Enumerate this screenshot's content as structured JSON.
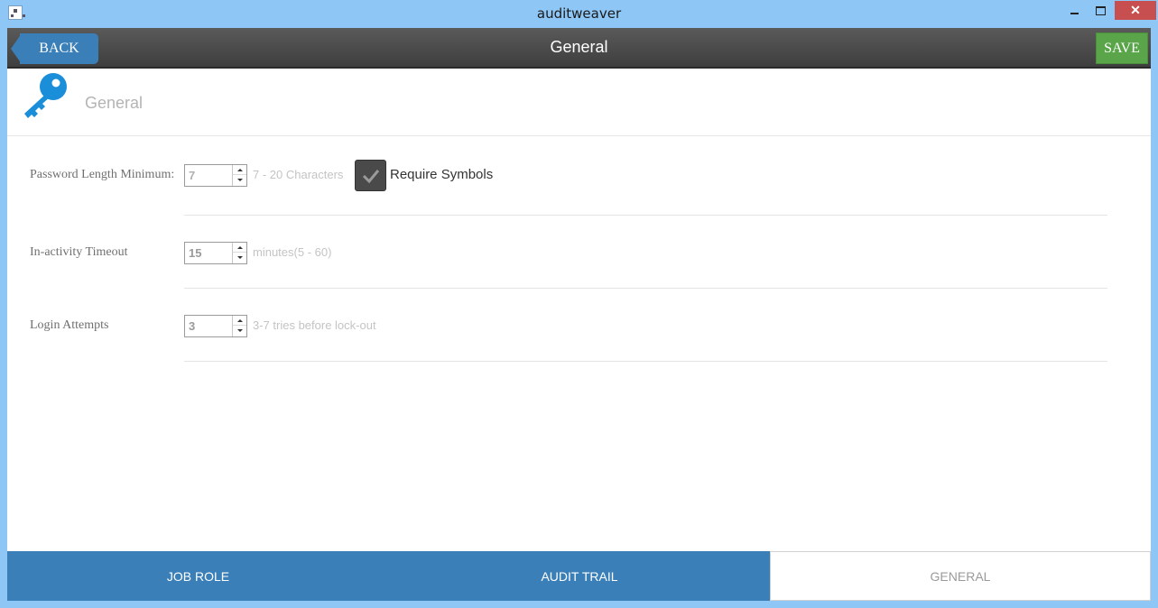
{
  "window": {
    "title": "auditweaver",
    "close_glyph": "✕"
  },
  "header": {
    "back_label": "BACK",
    "title": "General",
    "save_label": "SAVE"
  },
  "section": {
    "icon": "key-icon",
    "title": "General",
    "icon_color": "#1a8ed9"
  },
  "settings": {
    "password": {
      "label": "Password Length Minimum:",
      "value": "7",
      "hint": "7 - 20 Characters",
      "require_symbols_label": "Require Symbols",
      "require_symbols_checked": true
    },
    "timeout": {
      "label": "In-activity Timeout",
      "value": "15",
      "hint": "minutes(5 - 60)"
    },
    "login": {
      "label": "Login Attempts",
      "value": "3",
      "hint": "3-7 tries before lock-out"
    }
  },
  "tabs": [
    {
      "label": "JOB ROLE",
      "active": true
    },
    {
      "label": "AUDIT TRAIL",
      "active": true
    },
    {
      "label": "GENERAL",
      "active": false
    }
  ],
  "colors": {
    "accent": "#3a7fb8",
    "save": "#5aa54a",
    "header": "#4a4a4a",
    "titlebar": "#8ec6f5",
    "close": "#c74f4f"
  }
}
